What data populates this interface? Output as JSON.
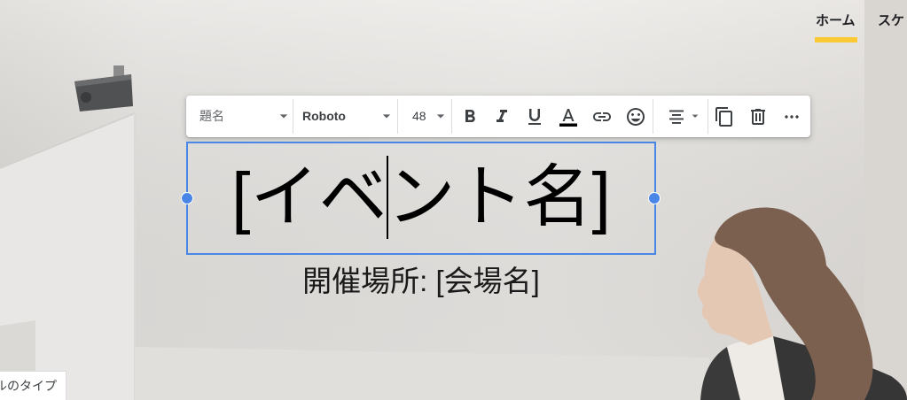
{
  "site_nav": {
    "items": [
      {
        "label": "ホーム",
        "active": true
      },
      {
        "label": "スケ",
        "active": false
      }
    ]
  },
  "toolbar": {
    "style_dropdown": {
      "value": "題名"
    },
    "font_dropdown": {
      "value": "Roboto"
    },
    "size_dropdown": {
      "value": "48"
    },
    "icons": {
      "dropdown": "dropdown-arrow-icon",
      "bold": "bold-icon",
      "italic": "italic-icon",
      "underline": "underline-icon",
      "text_color": "text-color-icon",
      "link": "link-icon",
      "emoji": "emoji-icon",
      "align": "align-center-icon",
      "duplicate": "copy-icon",
      "delete": "trash-icon",
      "more": "more-horiz-icon"
    }
  },
  "header": {
    "title": "[イベント名]",
    "subtitle": "開催場所: [会場名]"
  },
  "type_button": {
    "label": "ルのタイプ"
  },
  "colors": {
    "nav_indicator": "#fbc933",
    "selection": "#4a86e8",
    "text_color_swatch": "#000000",
    "title_text": "#000000"
  }
}
